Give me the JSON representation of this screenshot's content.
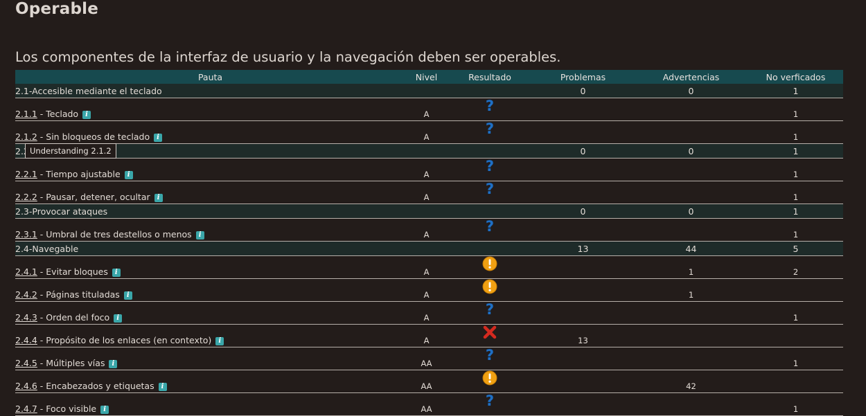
{
  "title": "Operable",
  "subtitle": "Los componentes de la interfaz de usuario y la navegación deben ser operables.",
  "columns": [
    "Pauta",
    "Nivel",
    "Resultado",
    "Problemas",
    "Advertencias",
    "No verficados"
  ],
  "tooltip": "Understanding 2.1.2",
  "rows": [
    {
      "type": "group",
      "name": "2.1-Accesible mediante el teclado",
      "problemas": "0",
      "advertencias": "0",
      "no_verificados": "1"
    },
    {
      "type": "crit",
      "code": "2.1.1",
      "label": " - Teclado",
      "nivel": "A",
      "result": "question-icon",
      "problemas": "",
      "advertencias": "",
      "no_verificados": "1"
    },
    {
      "type": "crit",
      "code": "2.1.2",
      "label": " - Sin bloqueos de teclado",
      "nivel": "A",
      "result": "question-icon",
      "problemas": "",
      "advertencias": "",
      "no_verificados": "1"
    },
    {
      "type": "group",
      "name": "2.2",
      "problemas": "0",
      "advertencias": "0",
      "no_verificados": "1"
    },
    {
      "type": "crit",
      "code": "2.2.1",
      "label": " - Tiempo ajustable",
      "nivel": "A",
      "result": "question-icon",
      "problemas": "",
      "advertencias": "",
      "no_verificados": "1"
    },
    {
      "type": "crit",
      "code": "2.2.2",
      "label": " - Pausar, detener, ocultar",
      "nivel": "A",
      "result": "question-icon",
      "problemas": "",
      "advertencias": "",
      "no_verificados": "1"
    },
    {
      "type": "group",
      "name": "2.3-Provocar ataques",
      "problemas": "0",
      "advertencias": "0",
      "no_verificados": "1"
    },
    {
      "type": "crit",
      "code": "2.3.1",
      "label": " - Umbral de tres destellos o menos",
      "nivel": "A",
      "result": "question-icon",
      "problemas": "",
      "advertencias": "",
      "no_verificados": "1"
    },
    {
      "type": "group",
      "name": "2.4-Navegable",
      "problemas": "13",
      "advertencias": "44",
      "no_verificados": "5"
    },
    {
      "type": "crit",
      "code": "2.4.1",
      "label": " - Evitar bloques",
      "nivel": "A",
      "result": "warning-icon",
      "problemas": "",
      "advertencias": "1",
      "no_verificados": "2"
    },
    {
      "type": "crit",
      "code": "2.4.2",
      "label": " - Páginas tituladas",
      "nivel": "A",
      "result": "warning-icon",
      "problemas": "",
      "advertencias": "1",
      "no_verificados": ""
    },
    {
      "type": "crit",
      "code": "2.4.3",
      "label": " - Orden del foco",
      "nivel": "A",
      "result": "question-icon",
      "problemas": "",
      "advertencias": "",
      "no_verificados": "1"
    },
    {
      "type": "crit",
      "code": "2.4.4",
      "label": " - Propósito de los enlaces (en contexto)",
      "nivel": "A",
      "result": "error-icon",
      "problemas": "13",
      "advertencias": "",
      "no_verificados": ""
    },
    {
      "type": "crit",
      "code": "2.4.5",
      "label": " - Múltiples vías",
      "nivel": "AA",
      "result": "question-icon",
      "problemas": "",
      "advertencias": "",
      "no_verificados": "1"
    },
    {
      "type": "crit",
      "code": "2.4.6",
      "label": " - Encabezados y etiquetas",
      "nivel": "AA",
      "result": "warning-icon",
      "problemas": "",
      "advertencias": "42",
      "no_verificados": ""
    },
    {
      "type": "crit",
      "code": "2.4.7",
      "label": " - Foco visible",
      "nivel": "AA",
      "result": "question-icon",
      "problemas": "",
      "advertencias": "",
      "no_verificados": "1"
    }
  ],
  "info_icon": "info-icon",
  "colors": {
    "background": "#231c1a",
    "header": "#174a4f",
    "group_row": "#1e2b29",
    "question": "#1f6fc4",
    "warning": "#f0a012",
    "error": "#d42a1f",
    "info": "#3aa6a9"
  }
}
